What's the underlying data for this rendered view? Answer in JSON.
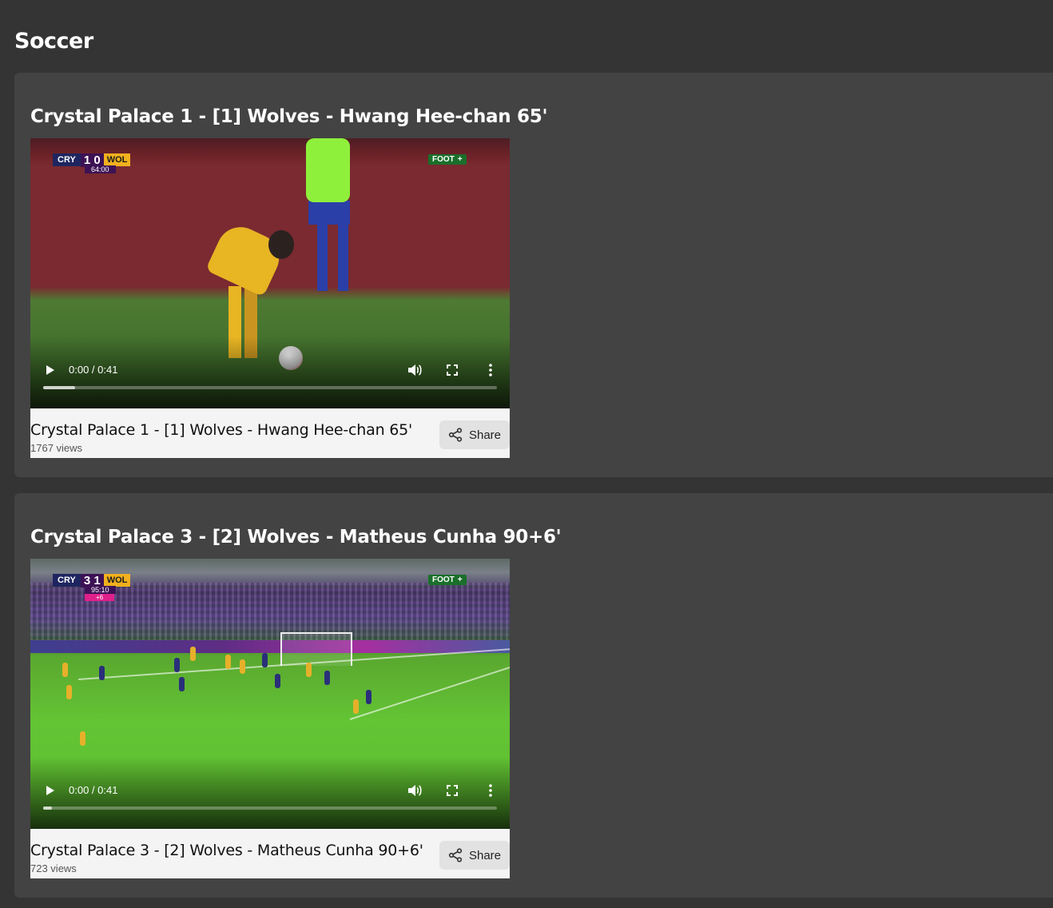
{
  "page": {
    "title": "Soccer"
  },
  "videos": [
    {
      "heading": "Crystal Palace 1 - [1] Wolves - Hwang Hee-chan 65'",
      "caption": "Crystal Palace 1 - [1] Wolves - Hwang Hee-chan 65'",
      "views": "1767 views",
      "share_label": "Share",
      "player": {
        "time": "0:00 / 0:41",
        "progress": 0.07
      },
      "scorebug": {
        "home": "CRY",
        "score": "1 0",
        "away": "WOL",
        "clock": "64:00",
        "added": "",
        "broadcaster": "FOOT",
        "broadcaster_plus": "+"
      }
    },
    {
      "heading": "Crystal Palace 3 - [2] Wolves - Matheus Cunha 90+6'",
      "caption": "Crystal Palace 3 - [2] Wolves - Matheus Cunha 90+6'",
      "views": "723 views",
      "share_label": "Share",
      "player": {
        "time": "0:00 / 0:41",
        "progress": 0.02
      },
      "scorebug": {
        "home": "CRY",
        "score": "3 1",
        "away": "WOL",
        "clock": "95:10",
        "added": "+6",
        "broadcaster": "FOOT",
        "broadcaster_plus": "+"
      }
    }
  ],
  "icons": {
    "play": "play-icon",
    "volume": "volume-icon",
    "fullscreen": "fullscreen-icon",
    "more": "more-vertical-icon",
    "share": "share-icon"
  },
  "colors": {
    "page_bg": "#343434",
    "card_bg": "#434343",
    "info_bg": "#f4f4f4",
    "share_bg": "#e2e2e2"
  }
}
